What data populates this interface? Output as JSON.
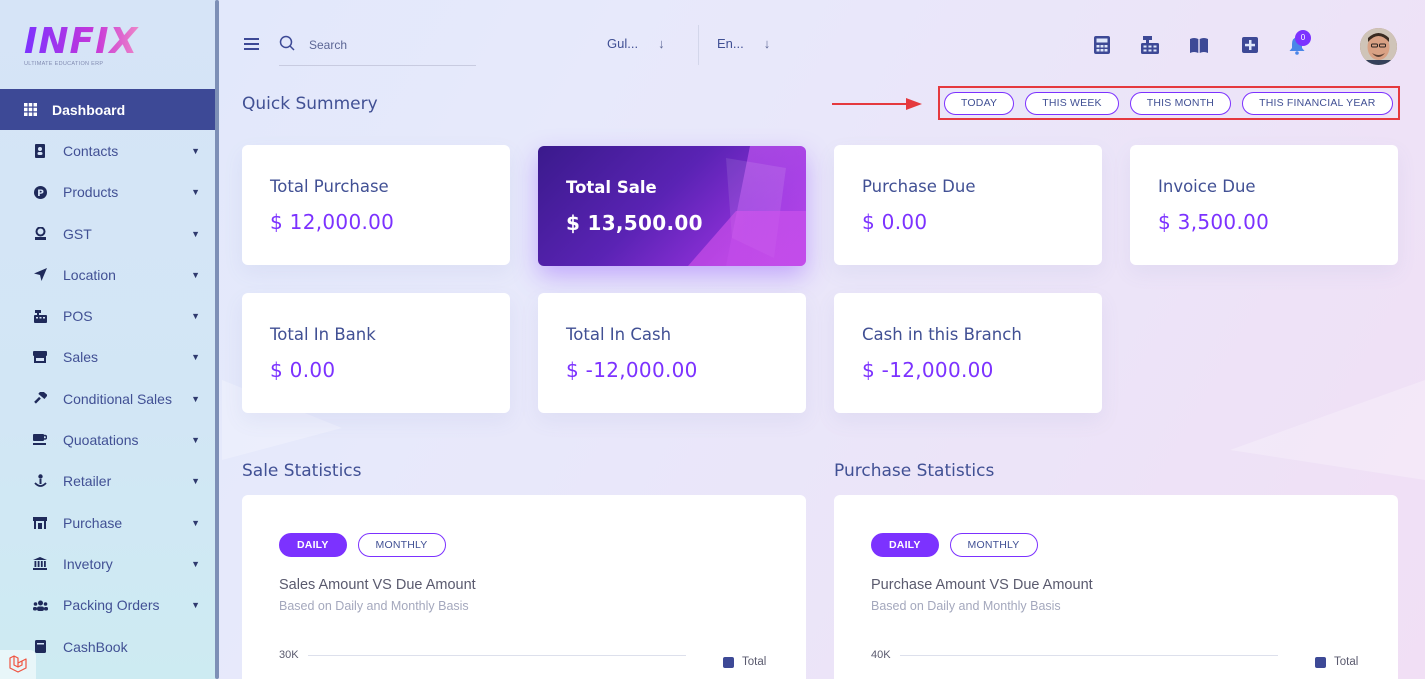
{
  "logo": {
    "text": "INFIX",
    "subtitle": "ULTIMATE EDUCATION ERP"
  },
  "sidebar": {
    "items": [
      {
        "label": "Dashboard",
        "icon": "grid-icon",
        "active": true
      },
      {
        "label": "Contacts",
        "icon": "address-book-icon"
      },
      {
        "label": "Products",
        "icon": "product-p-icon"
      },
      {
        "label": "GST",
        "icon": "user-tax-icon"
      },
      {
        "label": "Location",
        "icon": "location-arrow-icon"
      },
      {
        "label": "POS",
        "icon": "cash-register-icon"
      },
      {
        "label": "Sales",
        "icon": "store-icon"
      },
      {
        "label": "Conditional Sales",
        "icon": "gavel-icon"
      },
      {
        "label": "Quoatations",
        "icon": "coffee-icon"
      },
      {
        "label": "Retailer",
        "icon": "retailer-icon"
      },
      {
        "label": "Purchase",
        "icon": "shop-icon"
      },
      {
        "label": "Invetory",
        "icon": "bank-icon"
      },
      {
        "label": "Packing Orders",
        "icon": "users-icon"
      },
      {
        "label": "CashBook",
        "icon": "book-icon"
      }
    ]
  },
  "topbar": {
    "search_placeholder": "Search",
    "branch_select": "Gul...",
    "language_select": "En...",
    "notification_count": "0"
  },
  "quick_summary": {
    "title": "Quick Summery",
    "filters": [
      "TODAY",
      "THIS WEEK",
      "THIS MONTH",
      "THIS FINANCIAL YEAR"
    ],
    "cards": [
      {
        "title": "Total Purchase",
        "value": "$ 12,000.00"
      },
      {
        "title": "Total Sale",
        "value": "$ 13,500.00"
      },
      {
        "title": "Purchase Due",
        "value": "$ 0.00"
      },
      {
        "title": "Invoice Due",
        "value": "$ 3,500.00"
      },
      {
        "title": "Total In Bank",
        "value": "$ 0.00"
      },
      {
        "title": "Total In Cash",
        "value": "$ -12,000.00"
      },
      {
        "title": "Cash in this Branch",
        "value": "$ -12,000.00"
      }
    ]
  },
  "sale_statistics": {
    "heading": "Sale Statistics",
    "tabs": [
      "DAILY",
      "MONTHLY"
    ],
    "title": "Sales Amount VS Due Amount",
    "subtitle": "Based on Daily and Monthly Basis",
    "axis_top": "30K",
    "legend": "Total"
  },
  "purchase_statistics": {
    "heading": "Purchase Statistics",
    "tabs": [
      "DAILY",
      "MONTHLY"
    ],
    "title": "Purchase Amount VS Due Amount",
    "subtitle": "Based on Daily and Monthly Basis",
    "axis_top": "40K",
    "legend": "Total"
  },
  "colors": {
    "accent": "#7c32ff",
    "primary": "#415094",
    "sidebar_active": "#3d4996",
    "highlight_border": "#e5393e"
  }
}
